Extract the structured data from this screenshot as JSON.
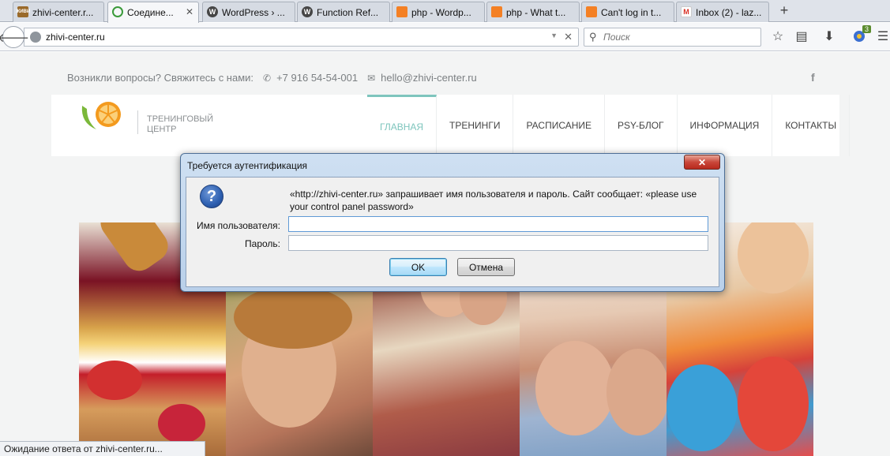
{
  "browser": {
    "tabs": [
      {
        "title": "zhivi-center.r...",
        "favicon_text": "ЖИВИ",
        "favicon_color": "#9a6a2a",
        "active": false
      },
      {
        "title": "Соедине...",
        "favicon_text": "",
        "favicon_color": "#3a9a3a",
        "active": true
      },
      {
        "title": "WordPress › ...",
        "favicon_text": "W",
        "favicon_color": "#464646",
        "active": false
      },
      {
        "title": "Function Ref...",
        "favicon_text": "W",
        "favicon_color": "#464646",
        "active": false
      },
      {
        "title": "php - Wordp...",
        "favicon_text": "",
        "favicon_color": "#f48024",
        "active": false
      },
      {
        "title": "php - What t...",
        "favicon_text": "",
        "favicon_color": "#f48024",
        "active": false
      },
      {
        "title": "Can't log in t...",
        "favicon_text": "",
        "favicon_color": "#f48024",
        "active": false
      },
      {
        "title": "Inbox (2) - laz...",
        "favicon_text": "M",
        "favicon_color": "#d93025",
        "active": false
      }
    ],
    "new_tab_symbol": "+",
    "url": "zhivi-center.ru",
    "search_placeholder": "Поиск",
    "addon_badge": "3",
    "icons": [
      "back-icon",
      "globe-icon",
      "stop-icon",
      "search-icon",
      "bookmark-star-icon",
      "reading-list-icon",
      "download-icon",
      "addon-icon",
      "menu-icon"
    ]
  },
  "site": {
    "contact_prompt": "Возникли вопросы? Свяжитесь с нами:",
    "phone": "+7 916 54-54-001",
    "email": "hello@zhivi-center.ru",
    "social": "f",
    "logo_line1": "ТРЕНИНГОВЫЙ",
    "logo_line2": "ЦЕНТР",
    "menu": [
      "ГЛАВНАЯ",
      "ТРЕНИНГИ",
      "РАСПИСАНИЕ",
      "PSY-БЛОГ",
      "ИНФОРМАЦИЯ",
      "КОНТАКТЫ"
    ],
    "accent_color": "#7ec5bd"
  },
  "dialog": {
    "title": "Требуется аутентификация",
    "message": "«http://zhivi-center.ru» запрашивает имя пользователя и пароль. Сайт сообщает: «please use your control panel password»",
    "username_label": "Имя пользователя:",
    "username_value": "",
    "password_label": "Пароль:",
    "password_value": "",
    "ok_label": "OK",
    "cancel_label": "Отмена"
  },
  "status_text": "Ожидание ответа от zhivi-center.ru..."
}
